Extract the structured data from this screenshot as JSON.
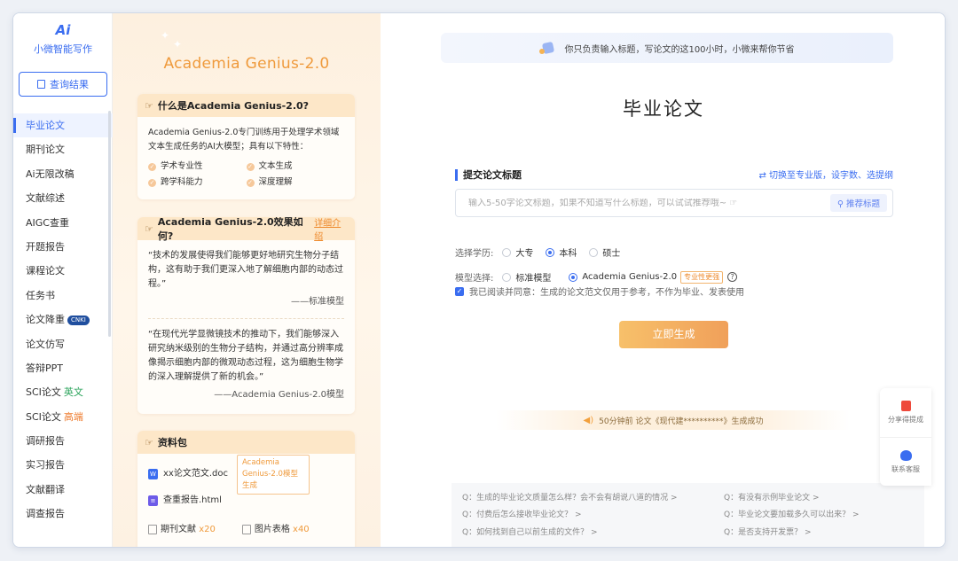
{
  "sidebar": {
    "logo_mark": "Ai",
    "logo_text": "小微智能写作",
    "query_label": "查询结果",
    "items": [
      {
        "label": "毕业论文",
        "active": true
      },
      {
        "label": "期刊论文"
      },
      {
        "label": "Ai无限改稿"
      },
      {
        "label": "文献综述"
      },
      {
        "label": "AIGC查重"
      },
      {
        "label": "开题报告"
      },
      {
        "label": "课程论文"
      },
      {
        "label": "任务书"
      },
      {
        "label": "论文降重",
        "badge": "CNKI"
      },
      {
        "label": "论文仿写"
      },
      {
        "label": "答辩PPT"
      },
      {
        "label": "SCI论文",
        "tag": "英文"
      },
      {
        "label": "SCI论文",
        "tag": "高端"
      },
      {
        "label": "调研报告"
      },
      {
        "label": "实习报告"
      },
      {
        "label": "文献翻译"
      },
      {
        "label": "调查报告"
      }
    ]
  },
  "info": {
    "title": "Academia Genius-2.0",
    "what_card": {
      "heading": "什么是Academia Genius-2.0?",
      "desc": "Academia Genius-2.0专门训练用于处理学术领域文本生成任务的AI大模型；具有以下特性：",
      "features": [
        "学术专业性",
        "文本生成",
        "跨学科能力",
        "深度理解"
      ]
    },
    "effect_card": {
      "heading": "Academia Genius-2.0效果如何?",
      "detail_link": "详细介绍",
      "quote1": "“技术的发展使得我们能够更好地研究生物分子结构，这有助于我们更深入地了解细胞内部的动态过程。”",
      "attr1": "——标准模型",
      "quote2": "“在现代光学显微镜技术的推动下，我们能够深入研究纳米级别的生物分子结构，并通过高分辨率成像揭示细胞内部的微观动态过程，这为细胞生物学的深入理解提供了新的机会。”",
      "attr2": "——Academia Genius-2.0模型"
    },
    "package_card": {
      "heading": "资料包",
      "file1": "xx论文范文.doc",
      "file1_tip": "Academia Genius-2.0模型生成",
      "file2": "查重报告.html",
      "res1_label": "期刊文献",
      "res1_count": "x20",
      "res2_label": "图片表格",
      "res2_count": "x40"
    }
  },
  "main": {
    "banner": "你只负责输入标题，写论文的这100小时，小微来帮你节省",
    "page_title": "毕业论文",
    "section_title": "提交论文标题",
    "switch_link": "⇄ 切换至专业版，设字数、选提纲",
    "title_placeholder": "输入5-50字论文标题，如果不知道写什么标题，可以试试推荐哦~ ☞",
    "recommend_label": "推荐标题",
    "degree_label": "选择学历:",
    "degrees": [
      {
        "label": "大专",
        "selected": false
      },
      {
        "label": "本科",
        "selected": true
      },
      {
        "label": "硕士",
        "selected": false
      }
    ],
    "model_label": "模型选择:",
    "models": [
      {
        "label": "标准模型",
        "selected": false
      },
      {
        "label": "Academia Genius-2.0",
        "selected": true,
        "badge": "专业性更强"
      }
    ],
    "agree_text": "我已阅读并同意：生成的论文范文仅用于参考，不作为毕业、发表使用",
    "generate_label": "立即生成",
    "notice": "50分钟前 论文《现代建**********》生成成功",
    "faq": [
      "Q：生成的毕业论文质量怎么样？会不会有胡说八道的情况 >",
      "Q：有没有示例毕业论文 >",
      "Q：付费后怎么接收毕业论文？ >",
      "Q：毕业论文要加载多久可以出来？ >",
      "Q：如何找到自己以前生成的文件？ >",
      "Q：是否支持开发票？ >"
    ]
  },
  "float_widget": {
    "share_label": "分享得提成",
    "service_label": "联系客服"
  },
  "colors": {
    "accent": "#3a6df0",
    "orange": "#ef9a3c"
  }
}
